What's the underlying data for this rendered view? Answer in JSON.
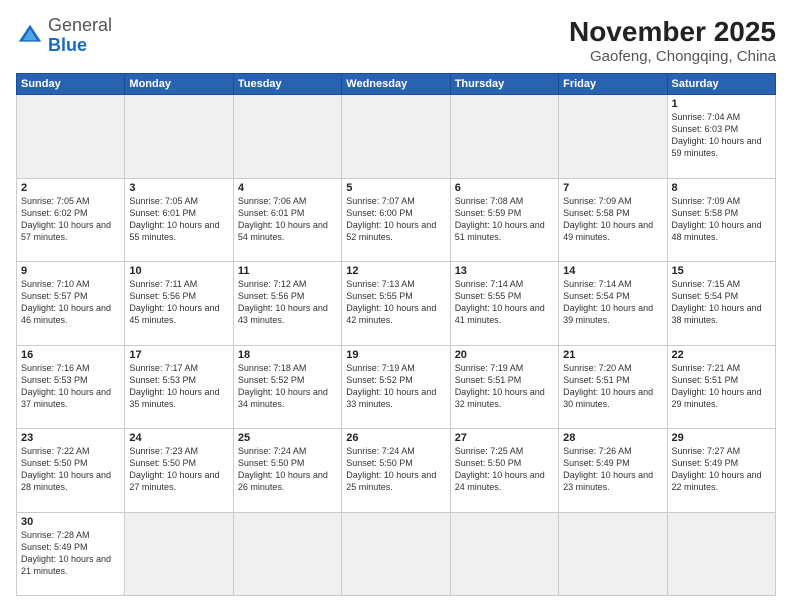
{
  "header": {
    "logo_general": "General",
    "logo_blue": "Blue",
    "title": "November 2025",
    "subtitle": "Gaofeng, Chongqing, China"
  },
  "days_of_week": [
    "Sunday",
    "Monday",
    "Tuesday",
    "Wednesday",
    "Thursday",
    "Friday",
    "Saturday"
  ],
  "weeks": [
    [
      {
        "day": "",
        "info": ""
      },
      {
        "day": "",
        "info": ""
      },
      {
        "day": "",
        "info": ""
      },
      {
        "day": "",
        "info": ""
      },
      {
        "day": "",
        "info": ""
      },
      {
        "day": "",
        "info": ""
      },
      {
        "day": "1",
        "info": "Sunrise: 7:04 AM\nSunset: 6:03 PM\nDaylight: 10 hours and 59 minutes."
      }
    ],
    [
      {
        "day": "2",
        "info": "Sunrise: 7:05 AM\nSunset: 6:02 PM\nDaylight: 10 hours and 57 minutes."
      },
      {
        "day": "3",
        "info": "Sunrise: 7:05 AM\nSunset: 6:01 PM\nDaylight: 10 hours and 55 minutes."
      },
      {
        "day": "4",
        "info": "Sunrise: 7:06 AM\nSunset: 6:01 PM\nDaylight: 10 hours and 54 minutes."
      },
      {
        "day": "5",
        "info": "Sunrise: 7:07 AM\nSunset: 6:00 PM\nDaylight: 10 hours and 52 minutes."
      },
      {
        "day": "6",
        "info": "Sunrise: 7:08 AM\nSunset: 5:59 PM\nDaylight: 10 hours and 51 minutes."
      },
      {
        "day": "7",
        "info": "Sunrise: 7:09 AM\nSunset: 5:58 PM\nDaylight: 10 hours and 49 minutes."
      },
      {
        "day": "8",
        "info": "Sunrise: 7:09 AM\nSunset: 5:58 PM\nDaylight: 10 hours and 48 minutes."
      }
    ],
    [
      {
        "day": "9",
        "info": "Sunrise: 7:10 AM\nSunset: 5:57 PM\nDaylight: 10 hours and 46 minutes."
      },
      {
        "day": "10",
        "info": "Sunrise: 7:11 AM\nSunset: 5:56 PM\nDaylight: 10 hours and 45 minutes."
      },
      {
        "day": "11",
        "info": "Sunrise: 7:12 AM\nSunset: 5:56 PM\nDaylight: 10 hours and 43 minutes."
      },
      {
        "day": "12",
        "info": "Sunrise: 7:13 AM\nSunset: 5:55 PM\nDaylight: 10 hours and 42 minutes."
      },
      {
        "day": "13",
        "info": "Sunrise: 7:14 AM\nSunset: 5:55 PM\nDaylight: 10 hours and 41 minutes."
      },
      {
        "day": "14",
        "info": "Sunrise: 7:14 AM\nSunset: 5:54 PM\nDaylight: 10 hours and 39 minutes."
      },
      {
        "day": "15",
        "info": "Sunrise: 7:15 AM\nSunset: 5:54 PM\nDaylight: 10 hours and 38 minutes."
      }
    ],
    [
      {
        "day": "16",
        "info": "Sunrise: 7:16 AM\nSunset: 5:53 PM\nDaylight: 10 hours and 37 minutes."
      },
      {
        "day": "17",
        "info": "Sunrise: 7:17 AM\nSunset: 5:53 PM\nDaylight: 10 hours and 35 minutes."
      },
      {
        "day": "18",
        "info": "Sunrise: 7:18 AM\nSunset: 5:52 PM\nDaylight: 10 hours and 34 minutes."
      },
      {
        "day": "19",
        "info": "Sunrise: 7:19 AM\nSunset: 5:52 PM\nDaylight: 10 hours and 33 minutes."
      },
      {
        "day": "20",
        "info": "Sunrise: 7:19 AM\nSunset: 5:51 PM\nDaylight: 10 hours and 32 minutes."
      },
      {
        "day": "21",
        "info": "Sunrise: 7:20 AM\nSunset: 5:51 PM\nDaylight: 10 hours and 30 minutes."
      },
      {
        "day": "22",
        "info": "Sunrise: 7:21 AM\nSunset: 5:51 PM\nDaylight: 10 hours and 29 minutes."
      }
    ],
    [
      {
        "day": "23",
        "info": "Sunrise: 7:22 AM\nSunset: 5:50 PM\nDaylight: 10 hours and 28 minutes."
      },
      {
        "day": "24",
        "info": "Sunrise: 7:23 AM\nSunset: 5:50 PM\nDaylight: 10 hours and 27 minutes."
      },
      {
        "day": "25",
        "info": "Sunrise: 7:24 AM\nSunset: 5:50 PM\nDaylight: 10 hours and 26 minutes."
      },
      {
        "day": "26",
        "info": "Sunrise: 7:24 AM\nSunset: 5:50 PM\nDaylight: 10 hours and 25 minutes."
      },
      {
        "day": "27",
        "info": "Sunrise: 7:25 AM\nSunset: 5:50 PM\nDaylight: 10 hours and 24 minutes."
      },
      {
        "day": "28",
        "info": "Sunrise: 7:26 AM\nSunset: 5:49 PM\nDaylight: 10 hours and 23 minutes."
      },
      {
        "day": "29",
        "info": "Sunrise: 7:27 AM\nSunset: 5:49 PM\nDaylight: 10 hours and 22 minutes."
      }
    ],
    [
      {
        "day": "30",
        "info": "Sunrise: 7:28 AM\nSunset: 5:49 PM\nDaylight: 10 hours and 21 minutes."
      },
      {
        "day": "",
        "info": ""
      },
      {
        "day": "",
        "info": ""
      },
      {
        "day": "",
        "info": ""
      },
      {
        "day": "",
        "info": ""
      },
      {
        "day": "",
        "info": ""
      },
      {
        "day": "",
        "info": ""
      }
    ]
  ]
}
